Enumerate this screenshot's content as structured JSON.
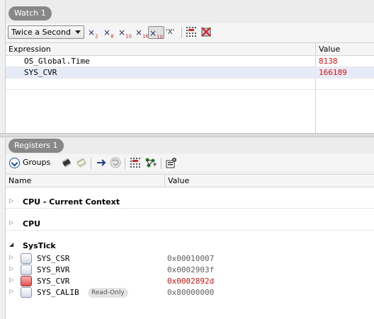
{
  "watch": {
    "tab_label": "Watch 1",
    "refresh_rate": "Twice a Second",
    "format_buttons": {
      "dec_x2": "×",
      "dec_x2_sub": "2",
      "dec_x8": "×",
      "dec_x8_sub": "8",
      "dec_x10": "×",
      "dec_x10_sub": "10",
      "dec_x16": "×",
      "dec_x16_sub": "16",
      "signed": "×",
      "signed_sub": "10",
      "char": "'X'"
    },
    "columns": {
      "expression": "Expression",
      "value": "Value"
    },
    "rows": [
      {
        "expression": "OS_Global.Time",
        "value": "8138"
      },
      {
        "expression": "SYS_CVR",
        "value": "166189"
      }
    ]
  },
  "registers": {
    "tab_label": "Registers 1",
    "groups_label": "Groups",
    "columns": {
      "name": "Name",
      "value": "Value"
    },
    "groups": [
      {
        "label": "CPU - Current Context",
        "expanded": false
      },
      {
        "label": "CPU",
        "expanded": false
      },
      {
        "label": "SysTick",
        "expanded": true
      }
    ],
    "systick_registers": [
      {
        "name": "SYS_CSR",
        "value": "0x00010007",
        "changed": false
      },
      {
        "name": "SYS_RVR",
        "value": "0x0002903f",
        "changed": false
      },
      {
        "name": "SYS_CVR",
        "value": "0x0002892d",
        "changed": true
      },
      {
        "name": "SYS_CALIB",
        "value": "0x80000000",
        "changed": false,
        "badge": "Read-Only"
      }
    ]
  }
}
